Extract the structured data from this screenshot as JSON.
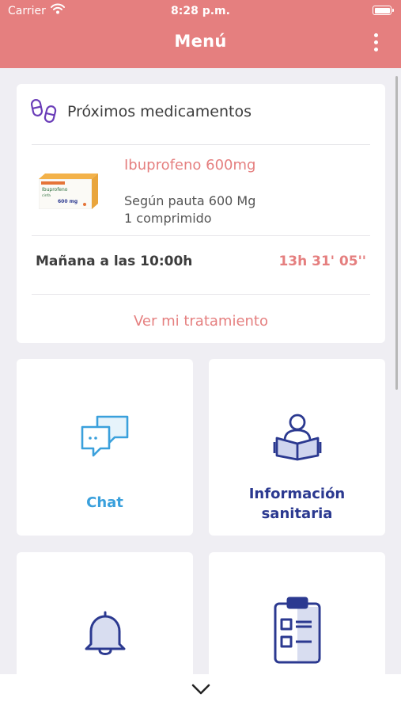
{
  "status": {
    "carrier": "Carrier",
    "time": "8:28 p.m."
  },
  "header": {
    "title": "Menú"
  },
  "medication": {
    "section_title": "Próximos medicamentos",
    "box_brand": "Ibuprofeno",
    "box_sub": "cinfa",
    "box_dose": "600 mg",
    "drug_name": "Ibuprofeno 600mg",
    "regimen": "Según pauta 600 Mg",
    "quantity": "1 comprimido",
    "next_dose": "Mañana a las 10:00h",
    "countdown": "13h 31' 05''",
    "link": "Ver mi tratamiento"
  },
  "tiles": {
    "chat": {
      "label": "Chat"
    },
    "info": {
      "line1": "Información",
      "line2": "sanitaria"
    }
  },
  "colors": {
    "brand": "#e57f7f",
    "chat_blue": "#3aa0dc",
    "navy": "#2b3990",
    "purple": "#6a3db8"
  }
}
